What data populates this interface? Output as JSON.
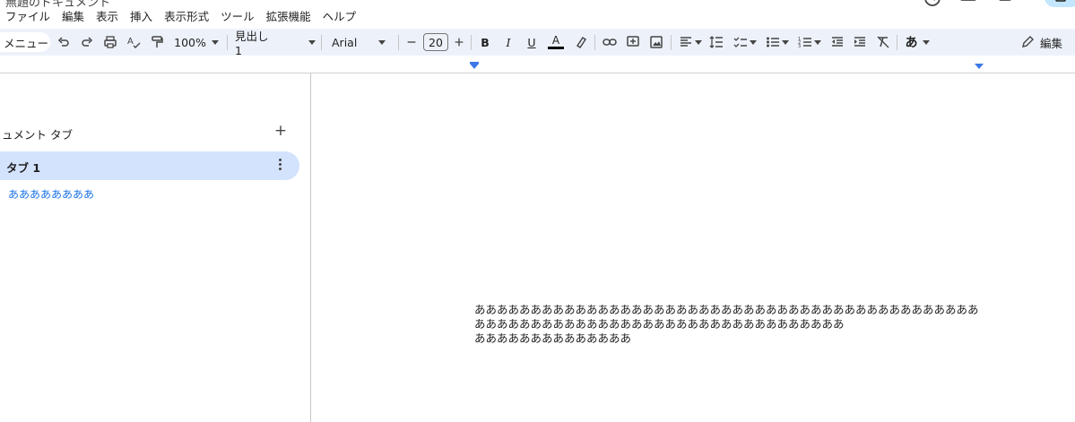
{
  "title": {
    "partial_text": "無題のドキュメント"
  },
  "menu": {
    "items": [
      "ファイル",
      "編集",
      "表示",
      "挿入",
      "表示形式",
      "ツール",
      "拡張機能",
      "ヘルプ"
    ]
  },
  "toolbar": {
    "menu_label": "メニュー",
    "zoom": "100%",
    "style": "見出し 1",
    "font": "Arial",
    "font_size": "20",
    "bold": "B",
    "italic": "I",
    "underline": "U",
    "text_color": "A",
    "ime": "あ",
    "edit_label": "編集"
  },
  "sidebar": {
    "header": "ュメント タブ",
    "add": "+",
    "tab_label": "タブ 1",
    "outline_item": "ああああああああ"
  },
  "document": {
    "paragraphs": [
      "ああああああああああああああああああああああああああああああああああああああああああああああああああああああああああああああああああああああああああああああ",
      "ああああああああああああああ"
    ]
  },
  "colors": {
    "toolbar_bg": "#edf2fa",
    "tab_active": "#d3e3fd",
    "accent": "#1a73e8"
  }
}
